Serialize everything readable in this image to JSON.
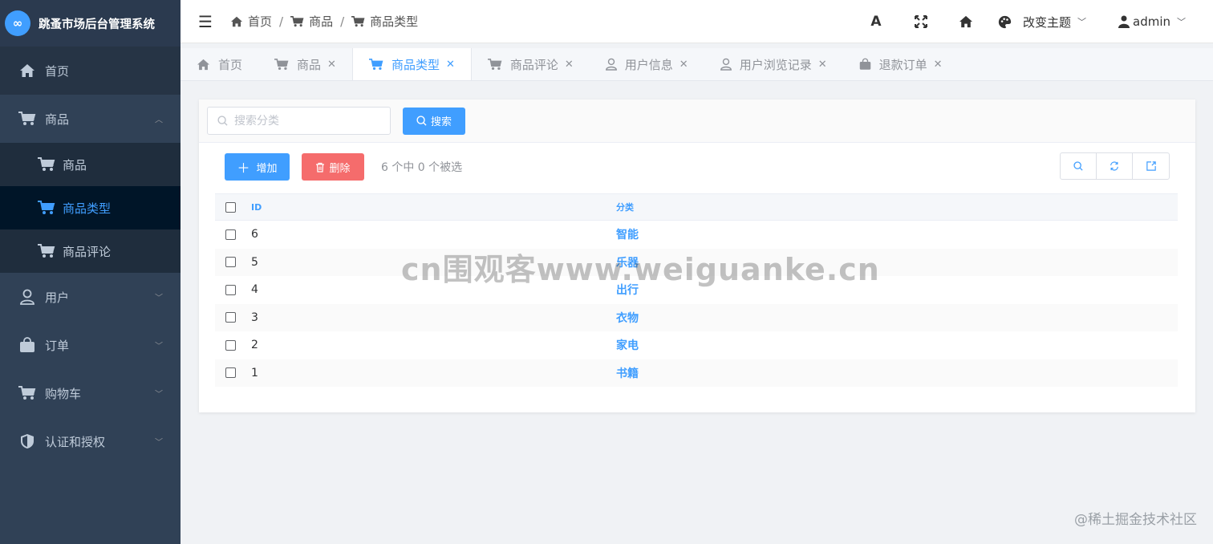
{
  "brand": {
    "title": "跳蚤市场后台管理系统"
  },
  "sidebar": {
    "items": [
      {
        "label": "首页"
      },
      {
        "label": "商品",
        "children": [
          {
            "label": "商品"
          },
          {
            "label": "商品类型"
          },
          {
            "label": "商品评论"
          }
        ]
      },
      {
        "label": "用户"
      },
      {
        "label": "订单"
      },
      {
        "label": "购物车"
      },
      {
        "label": "认证和授权"
      }
    ]
  },
  "header": {
    "breadcrumb": [
      "首页",
      "商品",
      "商品类型"
    ],
    "font_icon": "A",
    "theme_label": "改变主题",
    "user": "admin"
  },
  "tabs": [
    {
      "label": "首页"
    },
    {
      "label": "商品"
    },
    {
      "label": "商品类型"
    },
    {
      "label": "商品评论"
    },
    {
      "label": "用户信息"
    },
    {
      "label": "用户浏览记录"
    },
    {
      "label": "退款订单"
    }
  ],
  "search": {
    "placeholder": "搜索分类",
    "button": "搜索"
  },
  "toolbar": {
    "add": "增加",
    "delete": "删除",
    "selection": "6 个中 0 个被选"
  },
  "table": {
    "headers": {
      "id": "ID",
      "category": "分类"
    },
    "rows": [
      {
        "id": "6",
        "category": "智能"
      },
      {
        "id": "5",
        "category": "乐器"
      },
      {
        "id": "4",
        "category": "出行"
      },
      {
        "id": "3",
        "category": "衣物"
      },
      {
        "id": "2",
        "category": "家电"
      },
      {
        "id": "1",
        "category": "书籍"
      }
    ]
  },
  "watermarks": {
    "center": "cn围观客www.weiguanke.cn",
    "corner": "@稀土掘金技术社区"
  },
  "colors": {
    "sidebar": "#304156",
    "accent": "#409eff",
    "danger": "#f56c6c"
  }
}
